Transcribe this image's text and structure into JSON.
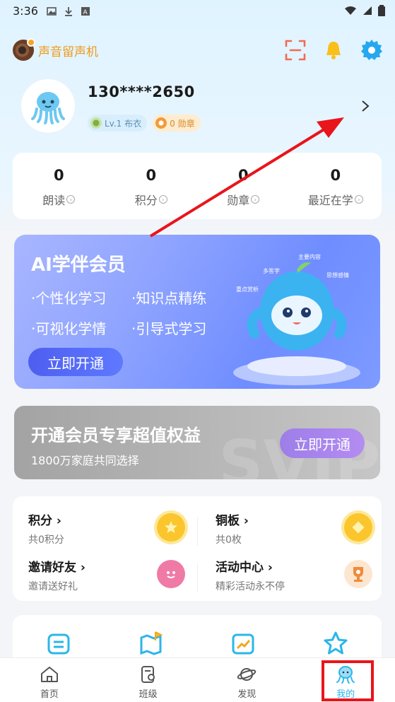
{
  "status_bar": {
    "time": "3:36"
  },
  "header": {
    "brand_name": "声音留声机"
  },
  "profile": {
    "phone": "130****2650",
    "level_badge": "Lv.1 布衣",
    "medal_badge": "0 勋章"
  },
  "stats": [
    {
      "value": "0",
      "label": "朗读"
    },
    {
      "value": "0",
      "label": "积分"
    },
    {
      "value": "0",
      "label": "勋章"
    },
    {
      "value": "0",
      "label": "最近在学"
    }
  ],
  "vip_banner": {
    "title": "AI学伴会员",
    "features": [
      "·个性化学习",
      "·知识点精练",
      "·可视化学情",
      "·引导式学习"
    ],
    "button": "立即开通",
    "mascot_tags": [
      "多答字",
      "主要内容",
      "思想感情",
      "重点赏析"
    ]
  },
  "promo": {
    "title": "开通会员专享超值权益",
    "subtitle": "1800万家庭共同选择",
    "button": "立即开通",
    "watermark": "SVIP"
  },
  "grid": [
    {
      "title": "积分",
      "sub": "共0积分",
      "icon": "coin-icon"
    },
    {
      "title": "铜板",
      "sub": "共0枚",
      "icon": "copper-coin-icon"
    },
    {
      "title": "邀请好友",
      "sub": "邀请送好礼",
      "icon": "smiley-heart-icon"
    },
    {
      "title": "活动中心",
      "sub": "精彩活动永不停",
      "icon": "trophy-icon"
    }
  ],
  "tabs": [
    {
      "label": "首页",
      "icon": "home-icon"
    },
    {
      "label": "班级",
      "icon": "class-icon"
    },
    {
      "label": "发现",
      "icon": "planet-icon"
    },
    {
      "label": "我的",
      "icon": "octopus-icon"
    }
  ],
  "colors": {
    "accent": "#2bb6ea",
    "brand_orange": "#f09a1a",
    "annotation_red": "#e8151b"
  }
}
